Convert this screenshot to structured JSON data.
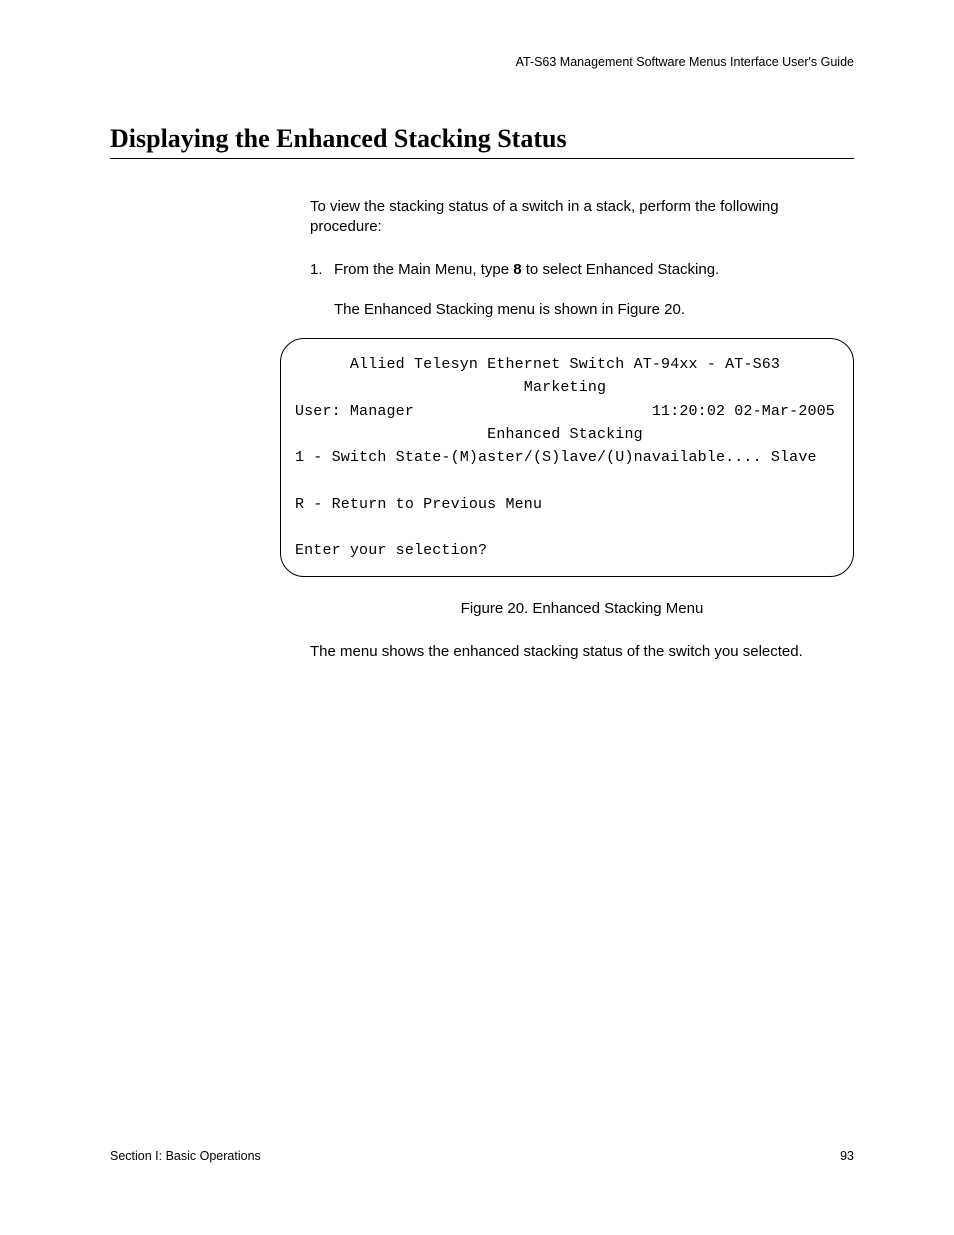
{
  "header": {
    "running_head": "AT-S63 Management Software Menus Interface User's Guide"
  },
  "title": "Displaying the Enhanced Stacking Status",
  "body": {
    "intro": "To view the stacking status of a switch in a stack, perform the following procedure:",
    "step1_num": "1.",
    "step1_pre": "From the Main Menu, type ",
    "step1_bold": "8",
    "step1_post": " to select Enhanced Stacking.",
    "step1_follow": "The Enhanced Stacking menu is shown in Figure 20.",
    "after_figure": "The menu shows the enhanced stacking status of the switch you selected."
  },
  "terminal": {
    "line1": "      Allied Telesyn Ethernet Switch AT-94xx - AT-S63",
    "line2": "                         Marketing",
    "line3": "User: Manager                          11:20:02 02-Mar-2005",
    "line4": "                     Enhanced Stacking",
    "line5": "1 - Switch State-(M)aster/(S)lave/(U)navailable.... Slave",
    "line6": "",
    "line7": "R - Return to Previous Menu",
    "line8": "",
    "line9": "Enter your selection?"
  },
  "figure_caption": "Figure 20. Enhanced Stacking Menu",
  "footer": {
    "section": "Section I: Basic Operations",
    "page": "93"
  }
}
